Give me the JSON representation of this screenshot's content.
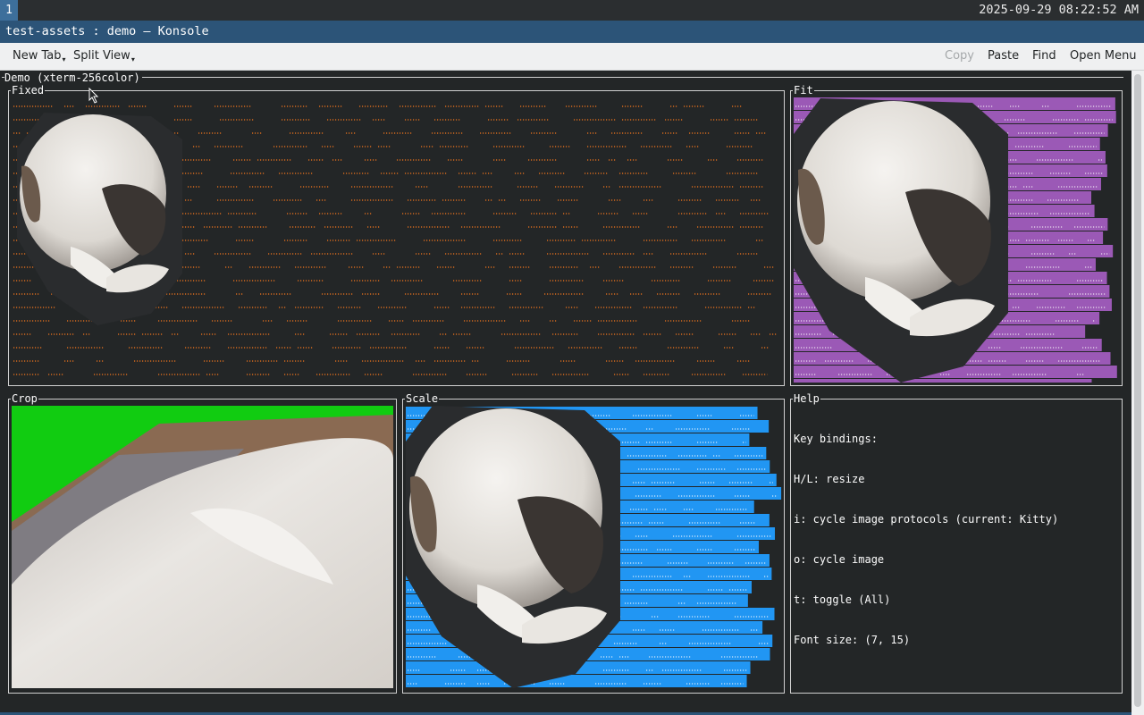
{
  "topbar": {
    "workspace": "1",
    "clock": "2025-09-29 08:22:52 AM"
  },
  "window": {
    "title": "test-assets : demo — Konsole"
  },
  "toolbar": {
    "new_tab": "New Tab",
    "split_view": "Split View",
    "copy": "Copy",
    "paste": "Paste",
    "find": "Find",
    "open_menu": "Open Menu"
  },
  "terminal": {
    "header": "Demo (xterm-256color)",
    "panes": {
      "fixed": "Fixed",
      "fit": "Fit",
      "crop": "Crop",
      "scale": "Scale",
      "help": "Help"
    },
    "help_lines": [
      "Key bindings:",
      "H/L: resize",
      "i: cycle image protocols (current: Kitty)",
      "o: cycle image",
      "t: toggle (All)",
      "Font size: (7, 15)"
    ]
  },
  "colors": {
    "fixed_fill": "#d2691e",
    "fit_fill": "#9b59b6",
    "scale_fill": "#2196f3",
    "crop_bg": "#11cc11"
  }
}
